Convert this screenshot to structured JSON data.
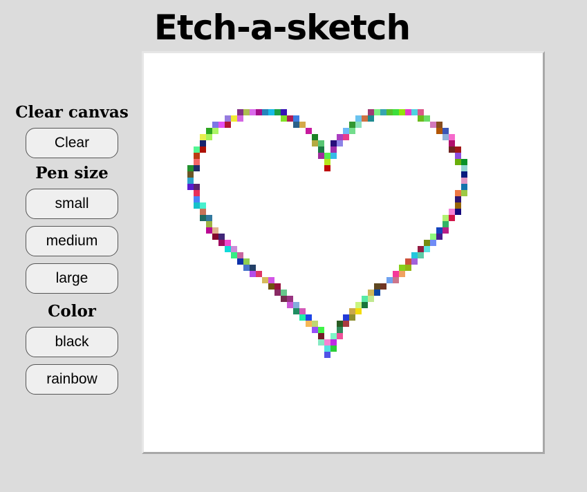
{
  "app": {
    "title": "Etch-a-sketch"
  },
  "sidebar": {
    "clear_heading": "Clear canvas",
    "clear_button": "Clear",
    "pen_heading": "Pen size",
    "pen_sizes": [
      "small",
      "medium",
      "large"
    ],
    "color_heading": "Color",
    "colors": [
      "black",
      "rainbow"
    ]
  },
  "canvas": {
    "shape": "heart outline",
    "color_mode": "rainbow",
    "background": "#ffffff"
  }
}
